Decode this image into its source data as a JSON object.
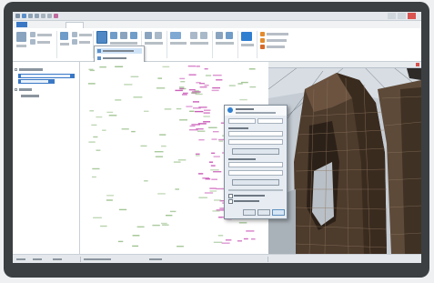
{
  "window": {
    "title": ""
  },
  "ribbon": {
    "tabs": [
      {
        "label": "",
        "active": false
      },
      {
        "label": "",
        "active": false
      },
      {
        "label": "",
        "active": false
      },
      {
        "label": "",
        "active": true
      },
      {
        "label": "",
        "active": false
      },
      {
        "label": "",
        "active": false
      },
      {
        "label": "",
        "active": false
      },
      {
        "label": "",
        "active": false
      },
      {
        "label": "",
        "active": false
      },
      {
        "label": "",
        "active": false
      }
    ]
  },
  "dropdown": {
    "items": [
      "",
      "",
      "",
      ""
    ]
  },
  "tree": {
    "items": [
      "",
      "",
      "",
      "",
      ""
    ]
  },
  "dialog": {
    "title": "",
    "ok_label": "",
    "cancel_label": "",
    "help_label": ""
  },
  "colors": {
    "frame": "#3b3f42",
    "accent": "#3a78c6",
    "label_magenta": "#c64fb3",
    "label_green": "#9ac08a",
    "mesh_brown": "#5a4331",
    "mesh_light": "#c8ced4",
    "ribbon_orange": "#e38b2c",
    "close_red": "#d9534f"
  },
  "icons": [
    "save-icon",
    "undo-icon",
    "redo-icon",
    "close-icon",
    "expand-icon",
    "info-icon"
  ]
}
